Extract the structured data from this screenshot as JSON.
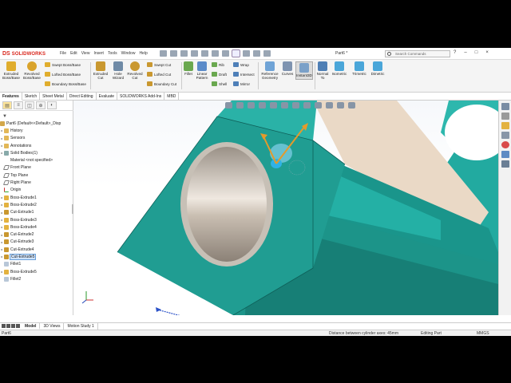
{
  "app": {
    "brand": "SOLIDWORKS",
    "brand_mark": "DS",
    "doc_title": "Part6 *"
  },
  "menu": [
    "File",
    "Edit",
    "View",
    "Insert",
    "Tools",
    "Window",
    "Help"
  ],
  "search": {
    "placeholder": "Search Commands"
  },
  "window_controls": [
    "?",
    "–",
    "□",
    "×"
  ],
  "ribbon": {
    "extruded_boss": "Extruded Boss/Base",
    "revolved_boss": "Revolved Boss/Base",
    "swept_boss": "Swept Boss/Base",
    "lofted_boss": "Lofted Boss/Base",
    "boundary_boss": "Boundary Boss/Base",
    "extruded_cut": "Extruded Cut",
    "hole_wizard": "Hole Wizard",
    "revolved_cut": "Revolved Cut",
    "swept_cut": "Swept Cut",
    "lofted_cut": "Lofted Cut",
    "boundary_cut": "Boundary Cut",
    "fillet": "Fillet",
    "linear_pattern": "Linear Pattern",
    "rib": "Rib",
    "draft": "Draft",
    "shell": "Shell",
    "wrap": "Wrap",
    "intersect": "Intersect",
    "mirror": "Mirror",
    "reference_geometry": "Reference Geometry",
    "curves": "Curves",
    "instant3d": "Instant3D",
    "normal_to": "Normal To",
    "isometric": "Isometric",
    "trimetric": "Trimetric",
    "dimetric": "Dimetric"
  },
  "cm_tabs": [
    "Features",
    "Sketch",
    "Sheet Metal",
    "Direct Editing",
    "Evaluate",
    "SOLIDWORKS Add-Ins",
    "MBD"
  ],
  "tree": {
    "root": "Part6  (Default<<Default>_Disp",
    "items": [
      {
        "label": "History",
        "icon": "folder"
      },
      {
        "label": "Sensors",
        "icon": "folder"
      },
      {
        "label": "Annotations",
        "icon": "folder"
      },
      {
        "label": "Solid Bodies(1)",
        "icon": "body"
      },
      {
        "label": "Material <not specified>",
        "icon": "material"
      },
      {
        "label": "Front Plane",
        "icon": "plane"
      },
      {
        "label": "Top Plane",
        "icon": "plane"
      },
      {
        "label": "Right Plane",
        "icon": "plane"
      },
      {
        "label": "Origin",
        "icon": "origin"
      },
      {
        "label": "Boss-Extrude1",
        "icon": "boss"
      },
      {
        "label": "Boss-Extrude2",
        "icon": "boss"
      },
      {
        "label": "Cut-Extrude1",
        "icon": "cut"
      },
      {
        "label": "Boss-Extrude3",
        "icon": "boss"
      },
      {
        "label": "Boss-Extrude4",
        "icon": "boss"
      },
      {
        "label": "Cut-Extrude2",
        "icon": "cut"
      },
      {
        "label": "Cut-Extrude3",
        "icon": "cut"
      },
      {
        "label": "Cut-Extrude4",
        "icon": "cut"
      },
      {
        "label": "Cut-Extrude5",
        "icon": "cut",
        "selected": true
      },
      {
        "label": "Fillet1",
        "icon": "fillet"
      },
      {
        "label": "Boss-Extrude5",
        "icon": "boss"
      },
      {
        "label": "Fillet2",
        "icon": "fillet"
      }
    ]
  },
  "bottom_tabs": [
    "Model",
    "3D Views",
    "Motion Study 1"
  ],
  "status": {
    "part": "Part6",
    "message": "Distance between cylinder axes: 45mm",
    "mode": "Editing Part",
    "units": "MMGS"
  },
  "colors": {
    "model_teal": "#1f9e93",
    "model_dark": "#157a72",
    "accent_blue": "#1c6fd1",
    "brand_red": "#d9261c"
  }
}
